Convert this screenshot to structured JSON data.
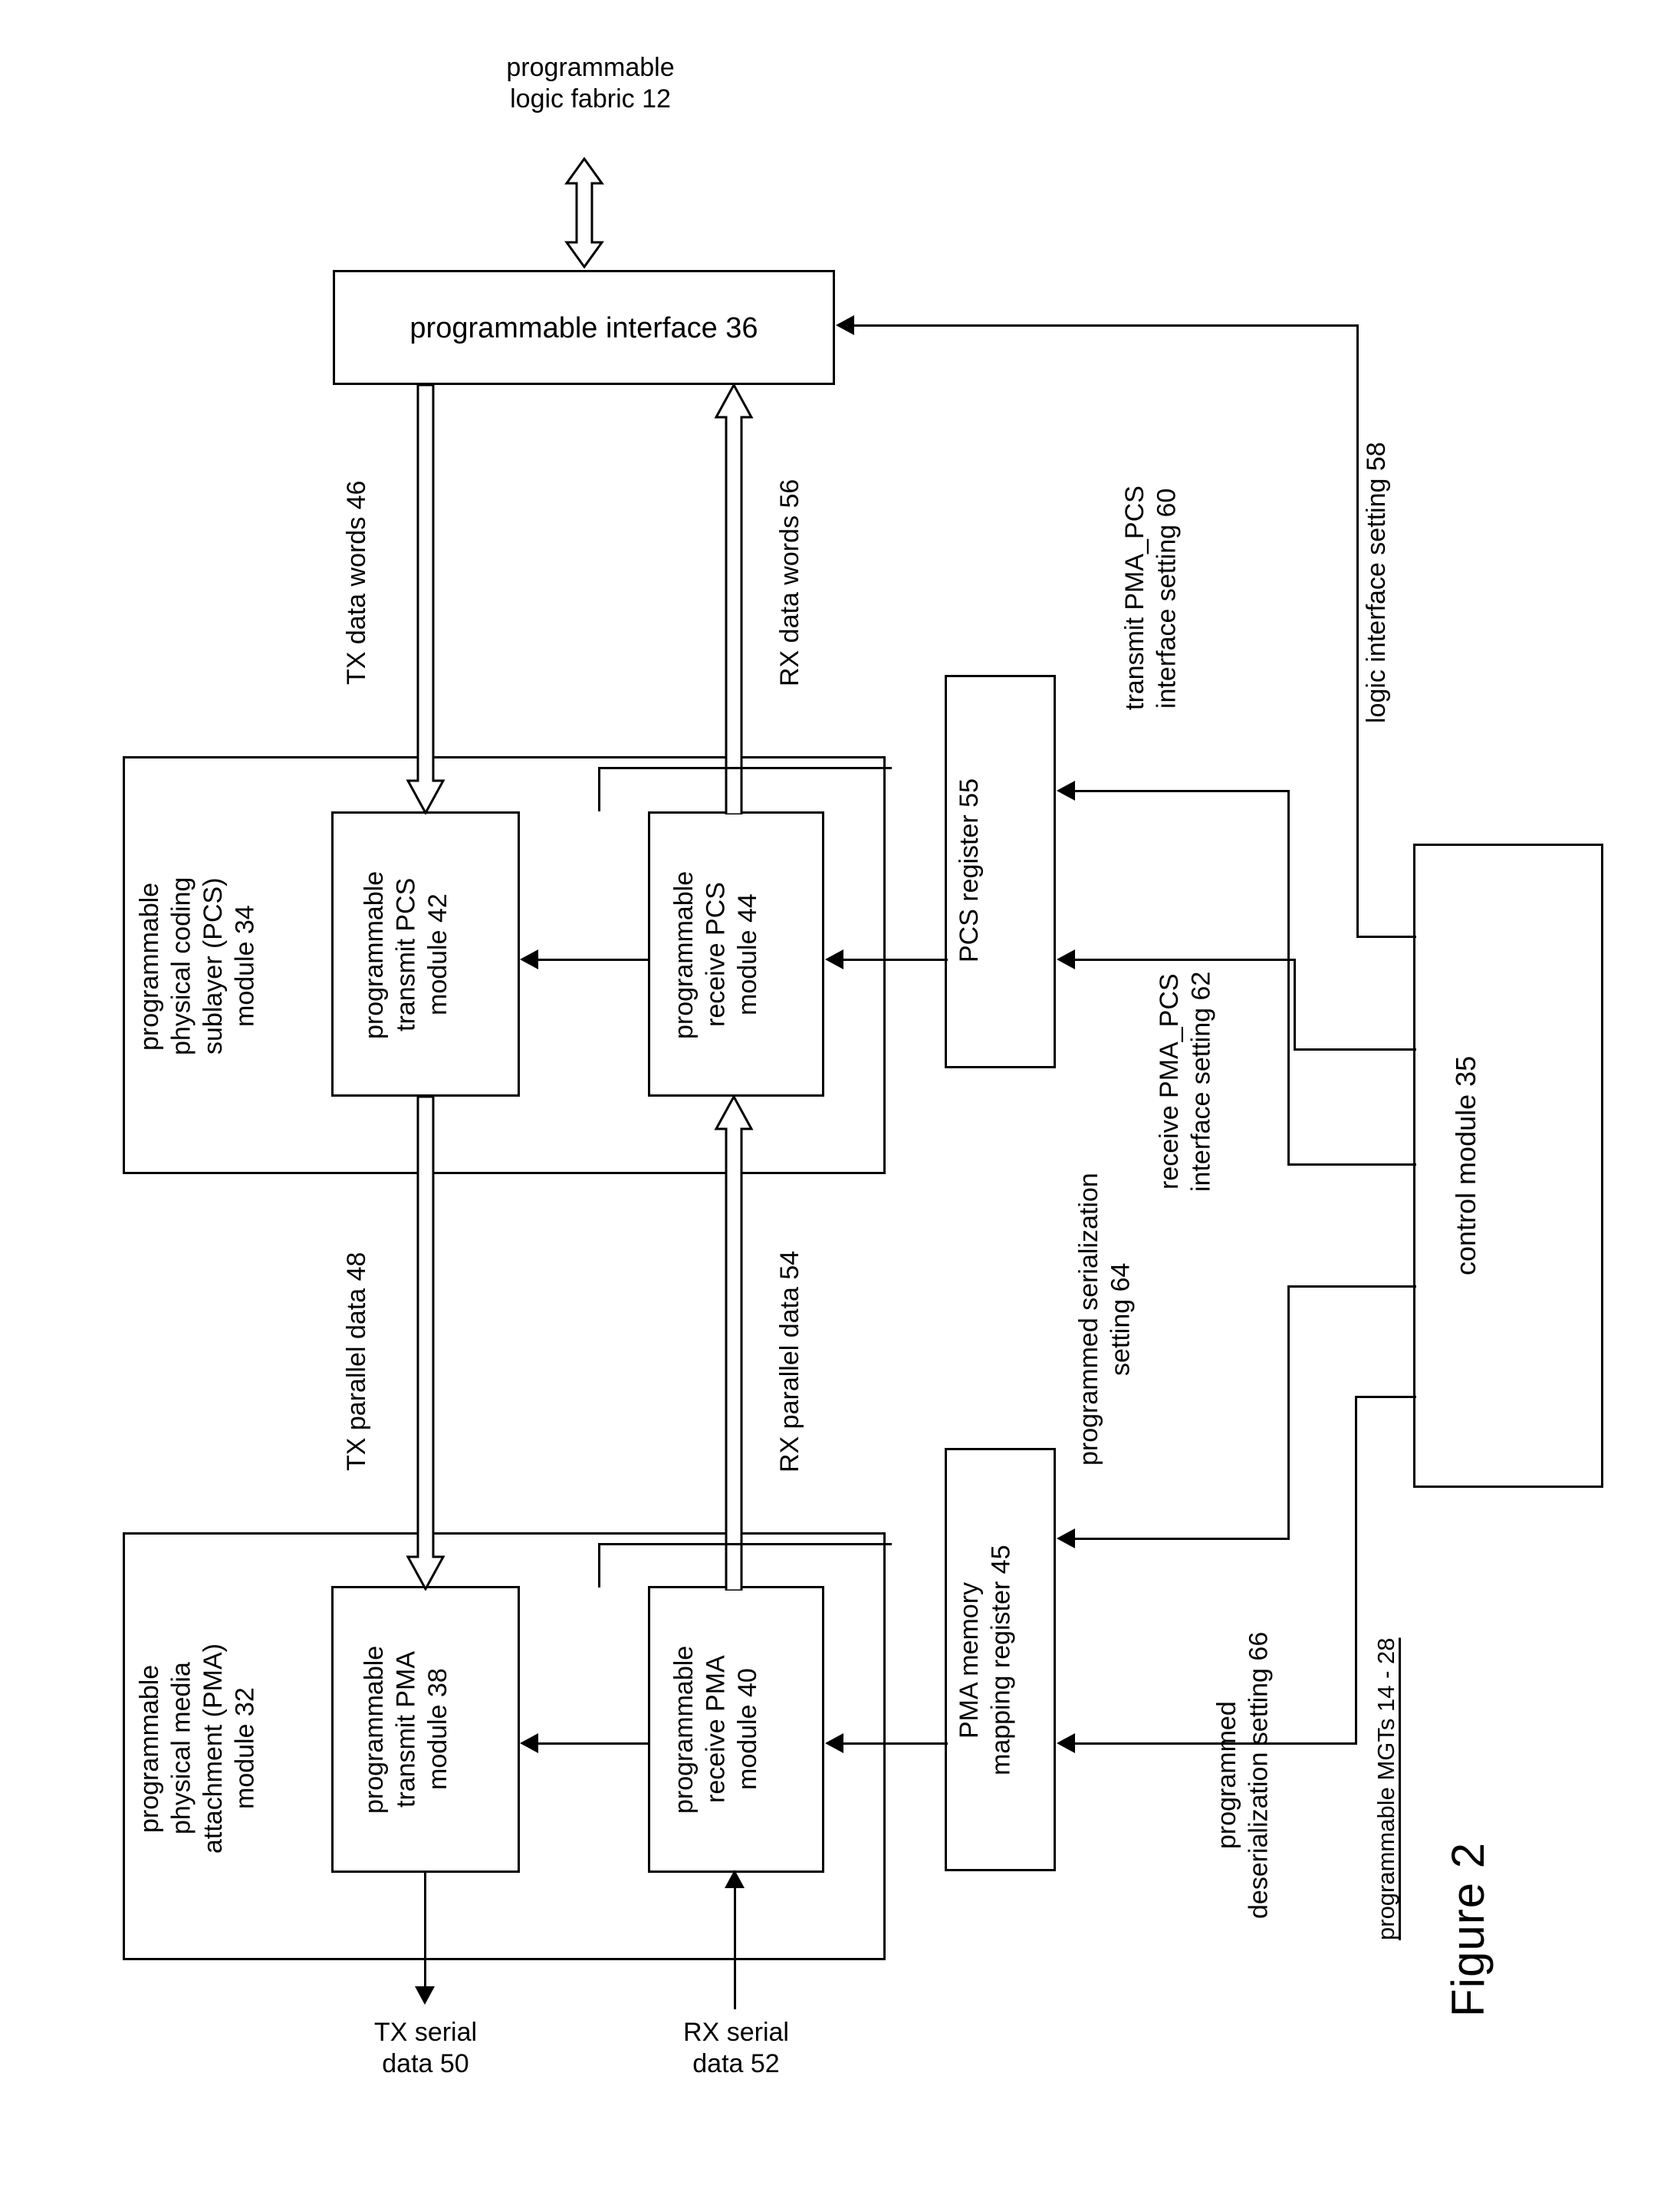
{
  "figure": {
    "caption": "Figure 2",
    "subcaption": "programmable MGTs 14 - 28"
  },
  "nodes": {
    "logic_fabric": "programmable\nlogic fabric 12",
    "prog_interface": "programmable interface 36",
    "pcs_group": "programmable\nphysical coding\nsublayer (PCS)\nmodule 34",
    "tx_pcs": "programmable\ntransmit PCS\nmodule 42",
    "rx_pcs": "programmable\nreceive PCS\nmodule 44",
    "pcs_register": "PCS register 55",
    "control_module": "control module 35",
    "pma_group": "programmable\nphysical media\nattachment (PMA)\nmodule 32",
    "tx_pma": "programmable\ntransmit PMA\nmodule 38",
    "rx_pma": "programmable\nreceive PMA\nmodule 40",
    "pma_register": "PMA memory\nmapping register 45"
  },
  "signals": {
    "tx_data_words": "TX data words 46",
    "rx_data_words": "RX data words 56",
    "tx_parallel_data": "TX parallel data 48",
    "rx_parallel_data": "RX parallel data 54",
    "tx_serial_data": "TX serial\ndata 50",
    "rx_serial_data": "RX serial\ndata 52",
    "logic_interface_setting": "logic interface setting 58",
    "transmit_pma_pcs": "transmit PMA_PCS\ninterface setting 60",
    "receive_pma_pcs": "receive PMA_PCS\ninterface setting 62",
    "programmed_serialization": "programmed serialization\nsetting 64",
    "programmed_deserialization": "programmed\ndeserialization setting 66"
  },
  "colors": {
    "stroke": "#000000",
    "background": "#ffffff"
  }
}
